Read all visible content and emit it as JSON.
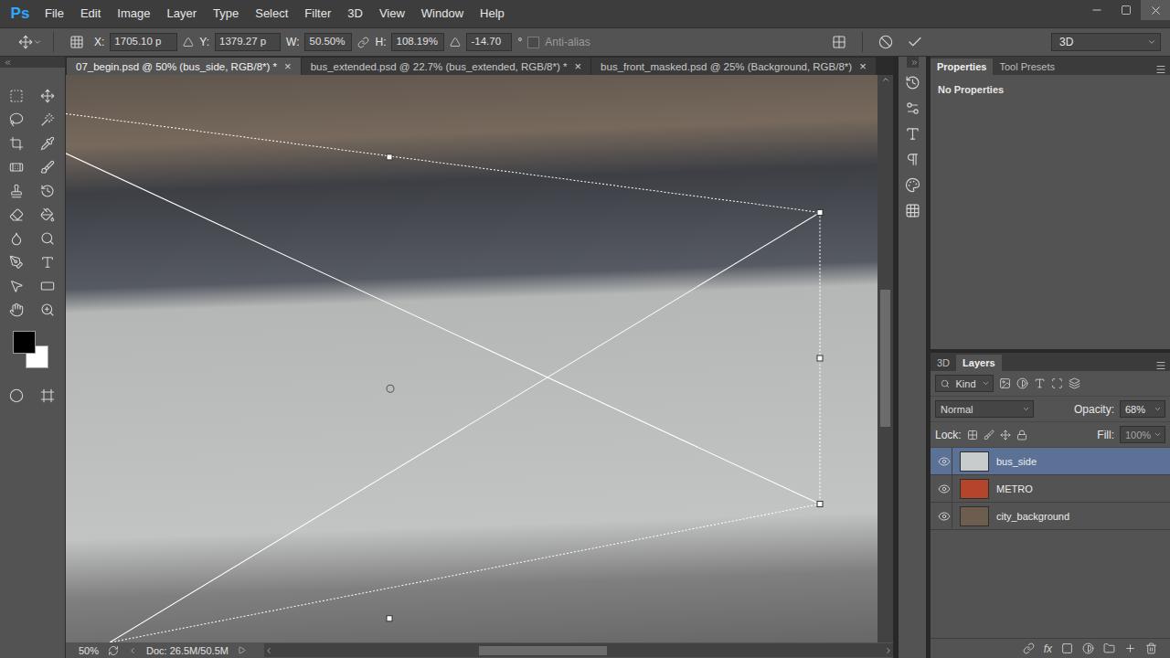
{
  "app": {
    "logo": "Ps"
  },
  "menu": [
    "File",
    "Edit",
    "Image",
    "Layer",
    "Type",
    "Select",
    "Filter",
    "3D",
    "View",
    "Window",
    "Help"
  ],
  "options_bar": {
    "x": {
      "label": "X:",
      "value": "1705.10 p"
    },
    "y": {
      "label": "Y:",
      "value": "1379.27 p"
    },
    "w": {
      "label": "W:",
      "value": "50.50%"
    },
    "h": {
      "label": "H:",
      "value": "108.19%"
    },
    "angle": {
      "value": "-14.70",
      "unit": "°"
    },
    "anti_alias": {
      "label": "Anti-alias",
      "checked": false,
      "disabled": true
    },
    "workspace": "3D"
  },
  "document_tabs": [
    {
      "label": "07_begin.psd @ 50% (bus_side, RGB/8*) *",
      "selected": true,
      "close": "×"
    },
    {
      "label": "bus_extended.psd @ 22.7% (bus_extended, RGB/8*) *",
      "selected": false,
      "close": "×"
    },
    {
      "label": "bus_front_masked.psd @ 25% (Background, RGB/8*)",
      "selected": false,
      "close": "×"
    }
  ],
  "colors": {
    "foreground": "#000000",
    "background": "#ffffff"
  },
  "status_bar": {
    "zoom": "50%",
    "doc": "Doc: 26.5M/50.5M"
  },
  "properties_panel": {
    "tabs": [
      {
        "label": "Properties",
        "selected": true
      },
      {
        "label": "Tool Presets",
        "selected": false
      }
    ],
    "message": "No Properties"
  },
  "layers_panel": {
    "tabs": [
      {
        "label": "3D",
        "selected": false
      },
      {
        "label": "Layers",
        "selected": true
      }
    ],
    "filter": "Kind",
    "blend_mode": "Normal",
    "opacity": {
      "label": "Opacity:",
      "value": "68%"
    },
    "lock": {
      "label": "Lock:"
    },
    "fill": {
      "label": "Fill:",
      "value": "100%"
    },
    "layers": [
      {
        "name": "bus_side",
        "visible": true,
        "selected": true,
        "color": "#c9cccd"
      },
      {
        "name": "METRO",
        "visible": true,
        "selected": false,
        "color": "#b5452a"
      },
      {
        "name": "city_background",
        "visible": true,
        "selected": false,
        "color": "#6c5d4f"
      }
    ],
    "footer_fx": "fx"
  }
}
